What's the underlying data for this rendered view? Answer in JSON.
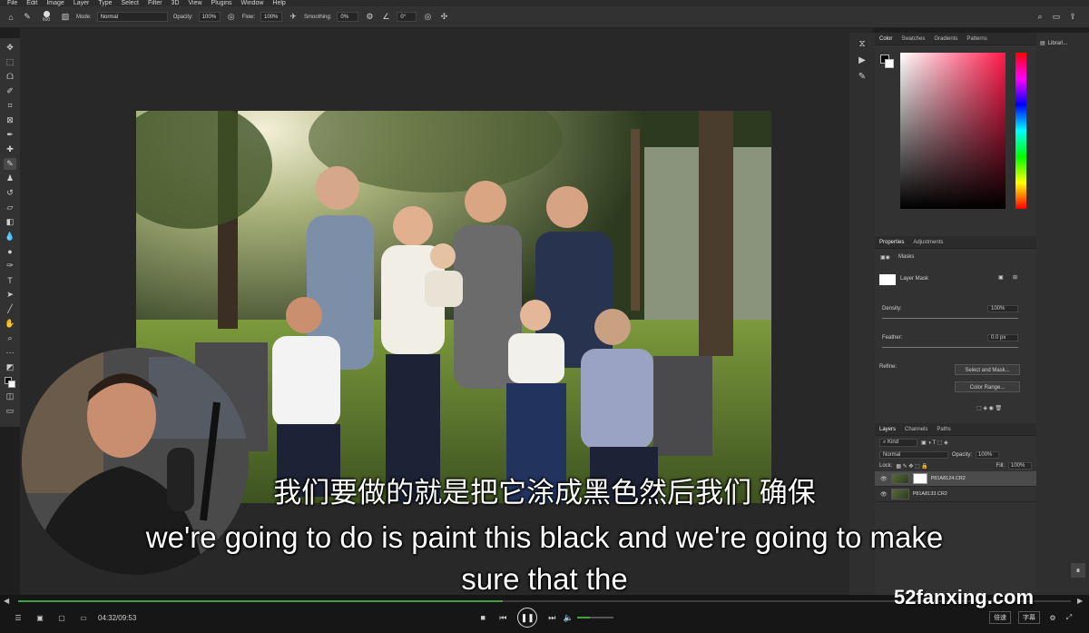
{
  "menu": [
    "File",
    "Edit",
    "Image",
    "Layer",
    "Type",
    "Select",
    "Filter",
    "3D",
    "View",
    "Plugins",
    "Window",
    "Help"
  ],
  "options_bar": {
    "brush_size": "600",
    "mode_label": "Mode:",
    "mode_value": "Normal",
    "opacity_label": "Opacity:",
    "opacity_value": "100%",
    "flow_label": "Flow:",
    "flow_value": "100%",
    "smoothing_label": "Smoothing:",
    "smoothing_value": "0%",
    "angle_value": "0°"
  },
  "color_panel": {
    "tabs": [
      "Color",
      "Swatches",
      "Gradients",
      "Patterns"
    ],
    "active_tab": "Color"
  },
  "properties_panel": {
    "tabs": [
      "Properties",
      "Adjustments"
    ],
    "section": "Masks",
    "mask_label": "Layer Mask",
    "density_label": "Density:",
    "density_value": "100%",
    "feather_label": "Feather:",
    "feather_value": "0.0 px",
    "refine_label": "Refine:",
    "select_mask_button": "Select and Mask...",
    "color_range_button": "Color Range..."
  },
  "layers_panel": {
    "tabs": [
      "Layers",
      "Channels",
      "Paths"
    ],
    "kind_value": "Kind",
    "blend_value": "Normal",
    "opacity_label": "Opacity:",
    "opacity_value": "100%",
    "lock_label": "Lock:",
    "fill_label": "Fill:",
    "fill_value": "100%",
    "layers": [
      {
        "name": "P81A8124.CR2",
        "selected": true,
        "has_mask": true
      },
      {
        "name": "P81A8133.CR2",
        "selected": false,
        "has_mask": false
      }
    ]
  },
  "libraries_label": "Librari...",
  "subtitles": {
    "chinese": "我们要做的就是把它涂成黑色然后我们 确保",
    "english_line1": "we're going to do is paint this black and we're going to make",
    "english_line2": "sure that the"
  },
  "player": {
    "time": "04:32/09:53",
    "progress": 0.46,
    "speed_label": "倍速",
    "subtitle_label": "字幕",
    "watermark": "52fanxing.com"
  },
  "colors": {
    "progress": "#3fa23f",
    "panel_bg": "#323232",
    "canvas_bg": "#282828"
  }
}
